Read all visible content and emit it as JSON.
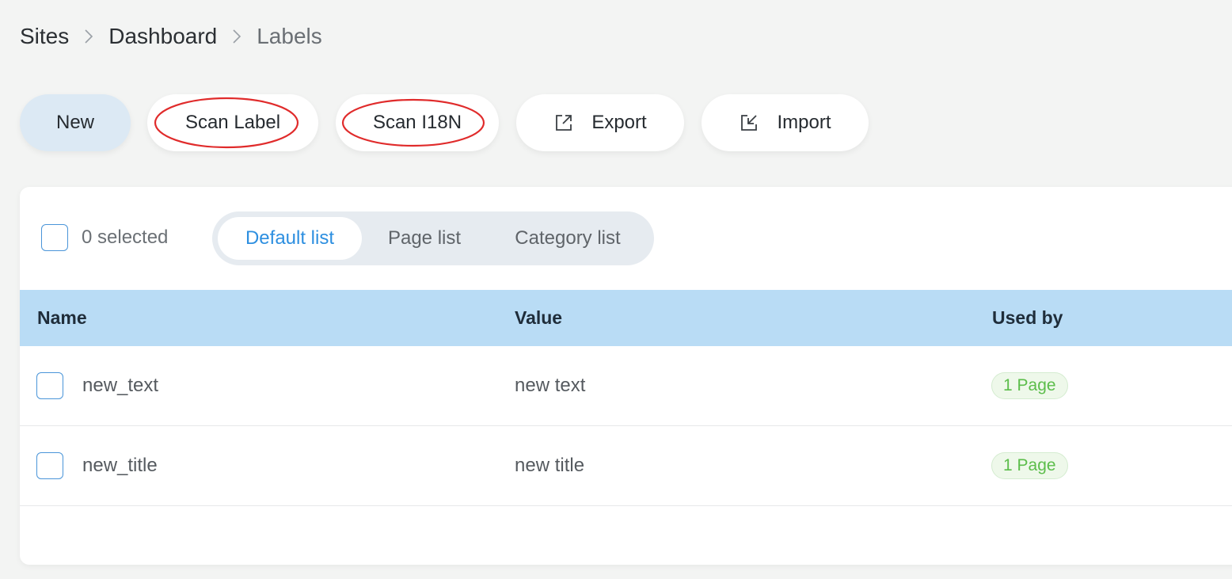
{
  "breadcrumb": {
    "items": [
      "Sites",
      "Dashboard",
      "Labels"
    ]
  },
  "toolbar": {
    "new_label": "New",
    "scan_label_label": "Scan Label",
    "scan_i18n_label": "Scan I18N",
    "export_label": "Export",
    "import_label": "Import",
    "export_icon": "external-link-icon",
    "import_icon": "import-arrow-icon"
  },
  "list": {
    "selected_count": "0 selected",
    "tabs": [
      "Default list",
      "Page list",
      "Category list"
    ],
    "active_tab": "Default list"
  },
  "table": {
    "columns": [
      "Name",
      "Value",
      "Used by"
    ],
    "rows": [
      {
        "name": "new_text",
        "value": "new text",
        "used_by": "1 Page"
      },
      {
        "name": "new_title",
        "value": "new title",
        "used_by": "1 Page"
      }
    ]
  },
  "colors": {
    "accent": "#2d8fe0",
    "header_bg": "#b9dcf5",
    "new_button_bg": "#dce9f4",
    "badge_text": "#5bbd4a",
    "annotation": "#e02b2b"
  }
}
